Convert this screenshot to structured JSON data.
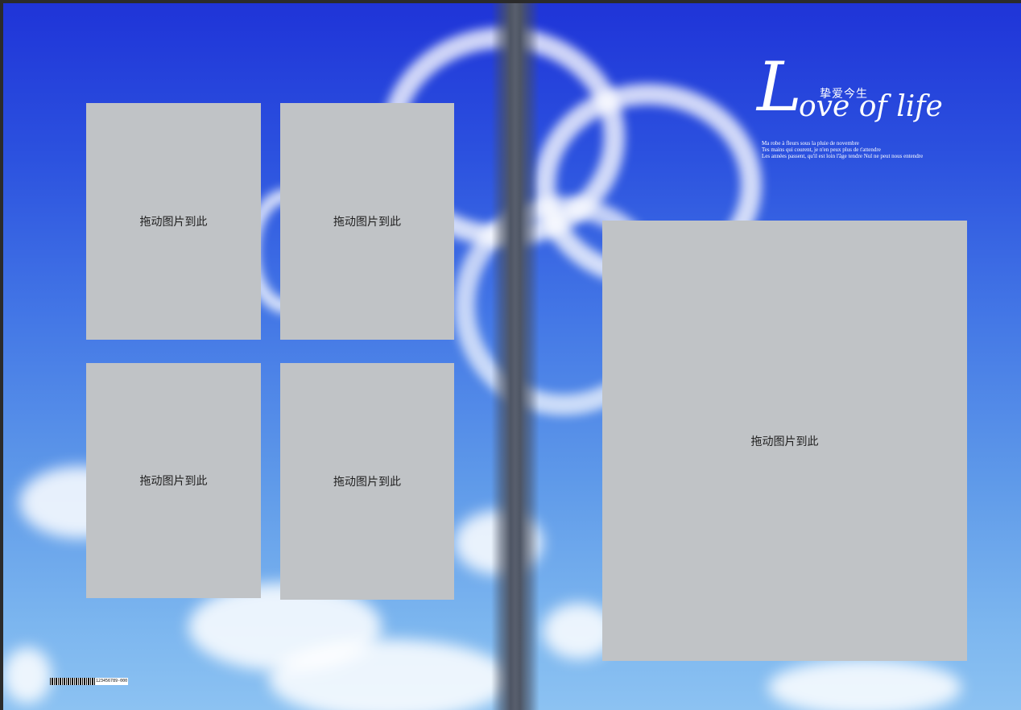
{
  "left_page": {
    "slots": [
      {
        "label": "拖动图片到此"
      },
      {
        "label": "拖动图片到此"
      },
      {
        "label": "拖动图片到此"
      },
      {
        "label": "拖动图片到此"
      }
    ],
    "barcode_number": "123456789-000"
  },
  "right_page": {
    "slot": {
      "label": "拖动图片到此"
    },
    "logo": {
      "chinese": "挚爱今生",
      "big_letter": "L",
      "phrase": "ove of life",
      "french_lines": [
        "Ma robe à fleurs sous la pluie de novembre",
        "Tes mains qui courent, je n'en peux plus de t'attendre",
        "Les années passent, qu'il est loin l'âge tendre Nul ne peut nous entendre"
      ]
    }
  },
  "colors": {
    "sky_top": "#1f34d8",
    "sky_bottom": "#8cc2f2",
    "placeholder": "#c0c3c6",
    "spine": "#585f6d"
  },
  "icons": [
    "barcode-icon",
    "heart-cloud"
  ]
}
